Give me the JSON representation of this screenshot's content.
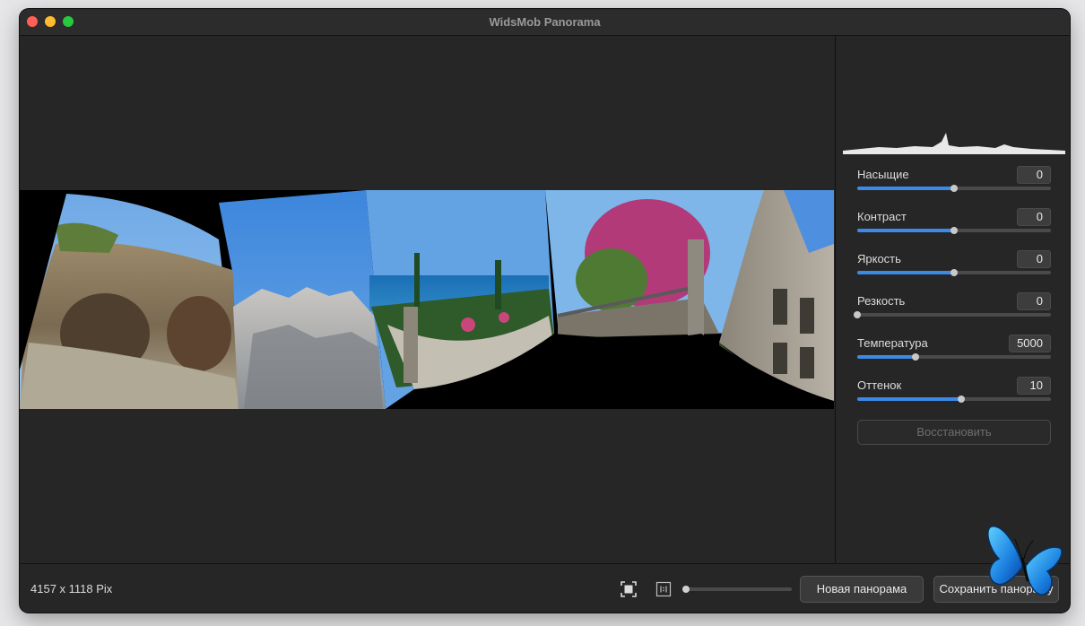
{
  "window": {
    "title": "WidsMob Panorama"
  },
  "adjustments": [
    {
      "label": "Насыщие",
      "value": "0",
      "level": 0.5
    },
    {
      "label": "Контраст",
      "value": "0",
      "level": 0.5
    },
    {
      "label": "Яркость",
      "value": "0",
      "level": 0.5
    },
    {
      "label": "Резкость",
      "value": "0",
      "level": 0.0
    },
    {
      "label": "Температура",
      "value": "5000",
      "level": 0.3
    },
    {
      "label": "Оттенок",
      "value": "10",
      "level": 0.535
    }
  ],
  "reset_label": "Восстановить",
  "status": {
    "dimensions": "4157 x 1118 Pix"
  },
  "zoom": {
    "level": 0.0
  },
  "buttons": {
    "new_panorama": "Новая панорама",
    "save_panorama": "Сохранить панораму"
  },
  "colors": {
    "accent": "#3b89e8",
    "traffic_red": "#fe5f57",
    "traffic_yellow": "#febc2e",
    "traffic_green": "#28c840"
  }
}
